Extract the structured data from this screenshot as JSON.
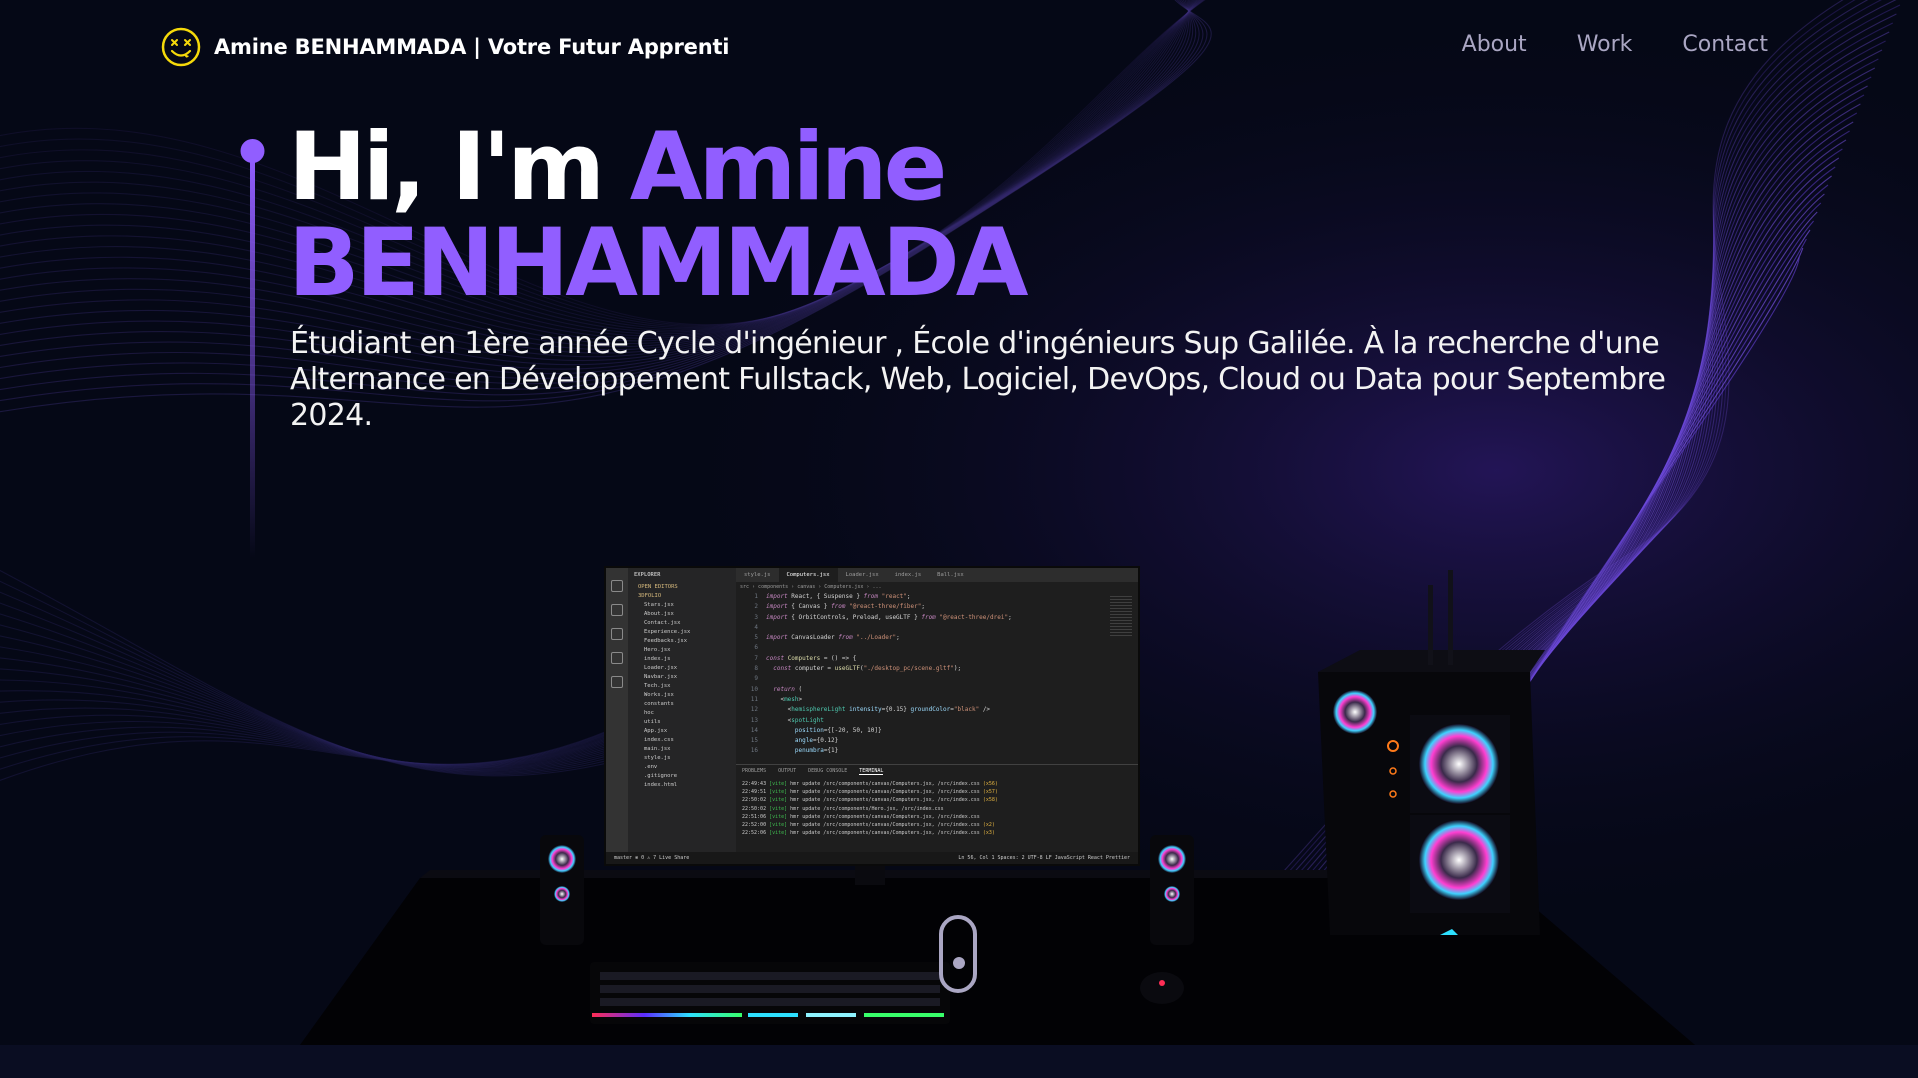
{
  "nav": {
    "brand": "Amine BENHAMMADA | Votre Futur Apprenti",
    "logo_icon": "smiley-face-icon",
    "links": [
      "About",
      "Work",
      "Contact"
    ]
  },
  "hero": {
    "greeting": "Hi, I'm ",
    "first_name": "Amine",
    "last_name": "BENHAMMADA",
    "subtitle": "Étudiant en 1ère année Cycle d'ingénieur , École d'ingénieurs Sup Galilée. À la recherche d'une Alternance en Développement Fullstack, Web, Logiciel, DevOps, Cloud ou Data pour Septembre 2024."
  },
  "scene": {
    "description_icons": [
      "desktop-pc-3d-model",
      "monitor-icon",
      "keyboard-icon",
      "speaker-icon",
      "pc-tower-icon"
    ],
    "editor": {
      "explorer_title": "EXPLORER",
      "open_editors": "OPEN EDITORS",
      "project": "3DFOLIO",
      "files": [
        "Stars.jsx",
        "About.jsx",
        "Contact.jsx",
        "Experience.jsx",
        "Feedbacks.jsx",
        "Hero.jsx",
        "index.js",
        "Loader.jsx",
        "Navbar.jsx",
        "Tech.jsx",
        "Works.jsx",
        "constants",
        "hoc",
        "utils",
        "App.jsx",
        "index.css",
        "main.jsx",
        "style.js",
        ".env",
        ".gitignore",
        "index.html"
      ],
      "tabs": [
        "style.js",
        "Computers.jsx",
        "Loader.jsx",
        "index.js",
        "Ball.jsx"
      ],
      "breadcrumb": "src › components › canvas › Computers.jsx › ...",
      "panel_tabs": [
        "PROBLEMS",
        "OUTPUT",
        "DEBUG CONSOLE",
        "TERMINAL"
      ],
      "status_left": "master  ⊗ 0 ⚠ 7  Live Share",
      "status_right": "Ln 56, Col 1  Spaces: 2  UTF-8  LF  JavaScript React  Prettier"
    }
  },
  "colors": {
    "background": "#050816",
    "accent": "#915eff",
    "nav_text": "#aaa6c3",
    "logo": "#f5d90a"
  }
}
